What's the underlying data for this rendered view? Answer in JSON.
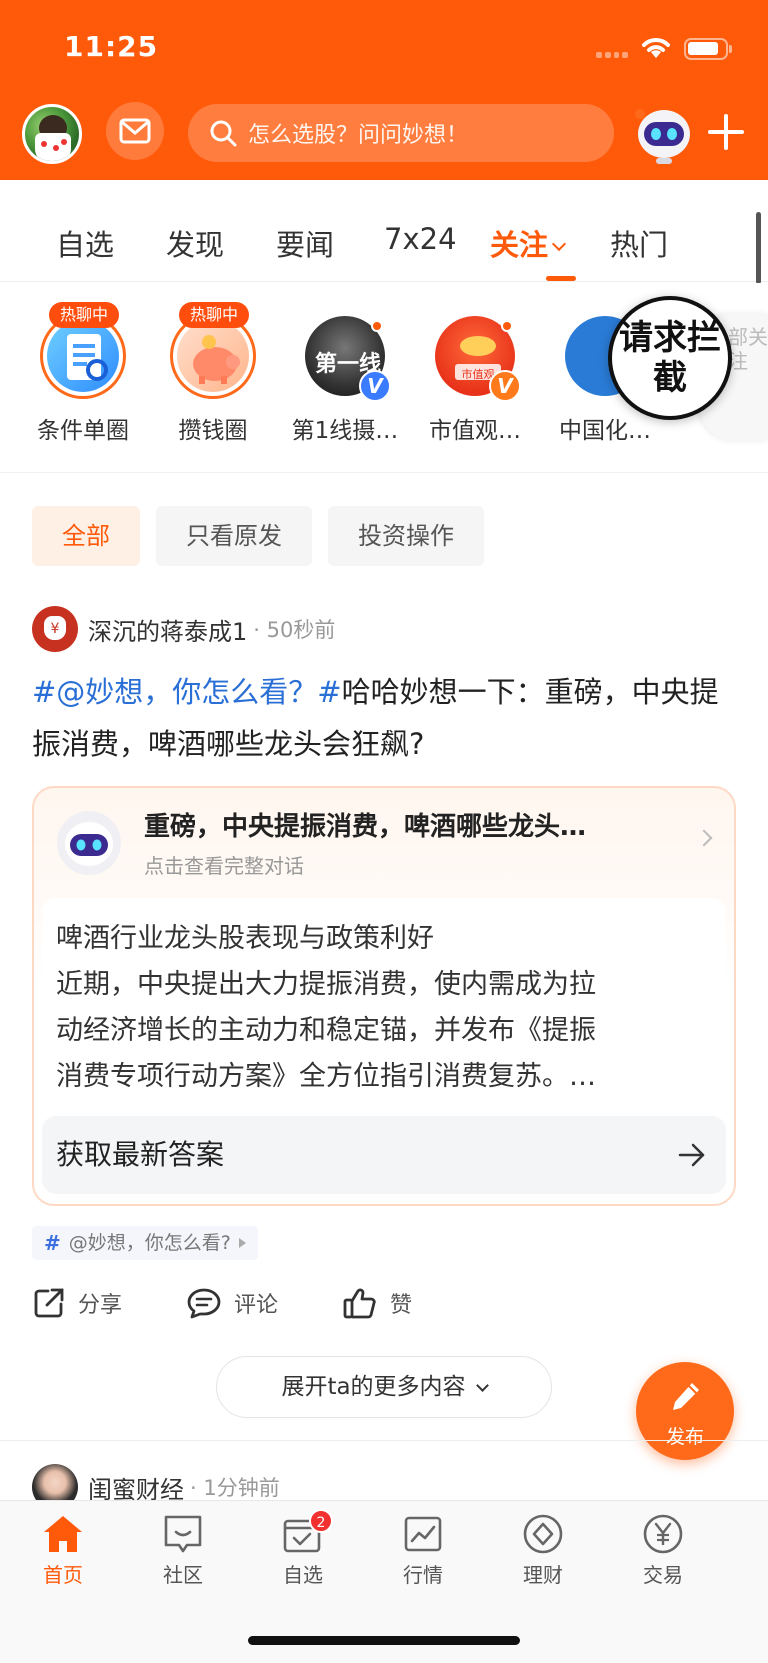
{
  "status_bar": {
    "time": "11:25"
  },
  "header": {
    "search_placeholder": "怎么选股？问问妙想！"
  },
  "tabs": [
    {
      "label": "自选"
    },
    {
      "label": "发现"
    },
    {
      "label": "要闻"
    },
    {
      "label": "7x24"
    },
    {
      "label": "关注",
      "active": true
    },
    {
      "label": "热门"
    }
  ],
  "circles": [
    {
      "name": "条件单圈",
      "badge": "热聊中"
    },
    {
      "name": "攒钱圈",
      "badge": "热聊中"
    },
    {
      "name": "第1线摄…",
      "avatar_text": "第一线",
      "verified": "V"
    },
    {
      "name": "市值观…",
      "avatar_text": "市值观",
      "verified": "V"
    },
    {
      "name": "中国化…"
    }
  ],
  "all_follow": "全部关注",
  "intercept_overlay": "请求拦截",
  "filters": [
    {
      "label": "全部",
      "active": true
    },
    {
      "label": "只看原发"
    },
    {
      "label": "投资操作"
    }
  ],
  "post": {
    "author": "深沉的蒋泰成1",
    "time": "· 50秒前",
    "tag_text": "#@妙想，你怎么看？#",
    "body_text": "哈哈妙想一下：重磅，中央提振消费，啤酒哪些龙头会狂飙?",
    "ai_card": {
      "question": "重磅，中央提振消费，啤酒哪些龙头…",
      "sub": "点击查看完整对话",
      "answer_lines": [
        "啤酒行业龙头股表现与政策利好",
        "近期，中央提出大力提振消费，使内需成为拉",
        "动经济增长的主动力和稳定锚，并发布《提振",
        "消费专项行动方案》全方位指引消费复苏。…"
      ],
      "get_latest": "获取最新答案"
    },
    "topic": "@妙想，你怎么看?",
    "actions": {
      "share": "分享",
      "comment": "评论",
      "like": "赞"
    },
    "expand": "展开ta的更多内容"
  },
  "publish_label": "发布",
  "next_post": {
    "author": "闺蜜财经",
    "time": "· 1分钟前"
  },
  "bottom_nav": [
    {
      "label": "首页",
      "active": true
    },
    {
      "label": "社区"
    },
    {
      "label": "自选",
      "badge": "2"
    },
    {
      "label": "行情"
    },
    {
      "label": "理财"
    },
    {
      "label": "交易"
    }
  ],
  "colors": {
    "brand": "#ff5a0a",
    "link": "#2a6fd6",
    "badge": "#f23030"
  }
}
